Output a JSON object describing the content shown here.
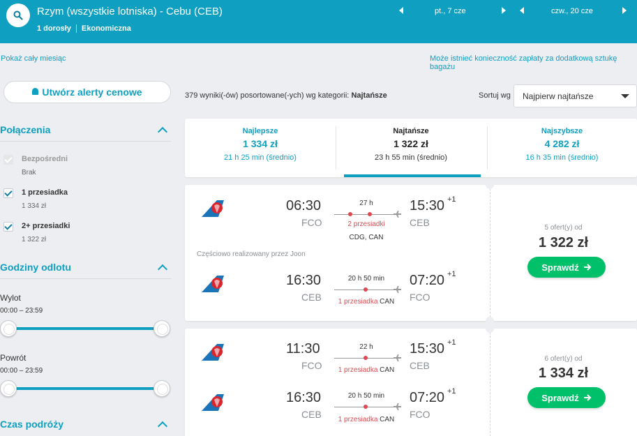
{
  "header": {
    "route": "Rzym (wszystkie lotniska) - Cebu (CEB)",
    "passengers": "1 dorosły",
    "cabin": "Ekonomiczna",
    "depart_date": "pt., 7 cze",
    "return_date": "czw., 20 cze"
  },
  "links": {
    "show_month": "Pokaż cały miesiąc",
    "baggage_notice": "Może istnieć konieczność zapłaty za dodatkową sztukę bagażu"
  },
  "sidebar": {
    "alert_button": "Utwórz alerty cenowe",
    "connections_title": "Połączenia",
    "connections": [
      {
        "label": "Bezpośredni",
        "sub": "Brak",
        "state": "disabled"
      },
      {
        "label": "1 przesiadka",
        "sub": "1 334 zł",
        "state": "checked"
      },
      {
        "label": "2+ przesiadki",
        "sub": "1 322 zł",
        "state": "checked"
      }
    ],
    "departure_title": "Godziny odlotu",
    "outbound_label": "Wylot",
    "outbound_range": "00:00 – 23:59",
    "return_label": "Powrót",
    "return_range": "00:00 – 23:59",
    "duration_title": "Czas podróży"
  },
  "results": {
    "count_text": "379 wyniki(-ów) posortowane(-ych) wg kategorii: ",
    "count_sort": "Najtańsze",
    "sort_label": "Sortuj wg",
    "sort_value": "Najpierw najtańsze"
  },
  "tabs": [
    {
      "title": "Najlepsze",
      "price": "1 334 zł",
      "duration": "21 h 25 min (średnio)"
    },
    {
      "title": "Najtańsze",
      "price": "1 322 zł",
      "duration": "23 h 55 min (średnio)"
    },
    {
      "title": "Najszybsze",
      "price": "4 282 zł",
      "duration": "16 h 35 min (średnio)"
    }
  ],
  "cards": [
    {
      "operated": "Częściowo realizowany przez Joon",
      "offers": "5 ofert(y) od",
      "price": "1 322 zł",
      "cta": "Sprawdź",
      "legs": [
        {
          "dep_time": "06:30",
          "dep_code": "FCO",
          "arr_time": "15:30",
          "arr_plus": "+1",
          "arr_code": "CEB",
          "duration": "27 h",
          "stops_label": "2 przesiadki",
          "stops_via": "",
          "via_line": "CDG, CAN"
        },
        {
          "dep_time": "16:30",
          "dep_code": "CEB",
          "arr_time": "07:20",
          "arr_plus": "+1",
          "arr_code": "FCO",
          "duration": "20 h 50 min",
          "stops_label": "1 przesiadka",
          "stops_via": " CAN",
          "via_line": ""
        }
      ]
    },
    {
      "operated": "",
      "offers": "6 ofert(y) od",
      "price": "1 334 zł",
      "cta": "Sprawdź",
      "legs": [
        {
          "dep_time": "11:30",
          "dep_code": "FCO",
          "arr_time": "15:30",
          "arr_plus": "+1",
          "arr_code": "CEB",
          "duration": "22 h",
          "stops_label": "1 przesiadka",
          "stops_via": " CAN",
          "via_line": ""
        },
        {
          "dep_time": "16:30",
          "dep_code": "CEB",
          "arr_time": "07:20",
          "arr_plus": "+1",
          "arr_code": "FCO",
          "duration": "20 h 50 min",
          "stops_label": "1 przesiadka",
          "stops_via": " CAN",
          "via_line": ""
        }
      ]
    }
  ],
  "colors": {
    "brand": "#0e9fc1",
    "cta": "#00c069",
    "stop_dot": "#e0484f"
  },
  "icons": {
    "search": "search-icon",
    "bell": "bell-icon",
    "airline": "airline-logo-icon",
    "plane": "plane-icon",
    "arrow": "arrow-right-icon"
  }
}
